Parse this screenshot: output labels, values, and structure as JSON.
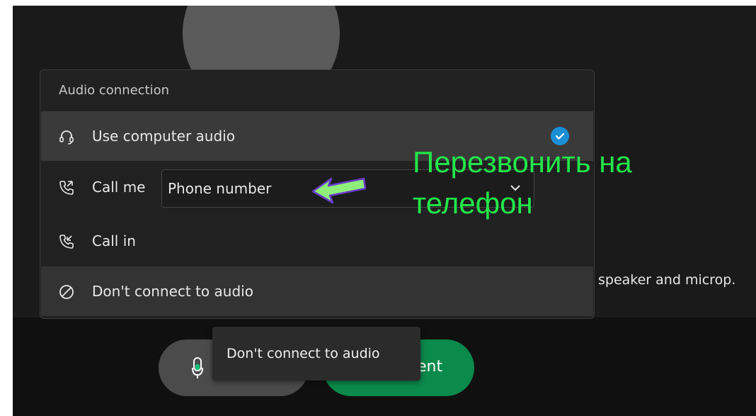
{
  "panel": {
    "title": "Audio connection",
    "options": [
      {
        "label": "Use computer audio",
        "icon": "headset-icon",
        "selected": true
      },
      {
        "label": "Call me",
        "icon": "phone-outgoing-icon"
      },
      {
        "label": "Call in",
        "icon": "phone-incoming-icon"
      },
      {
        "label": "Don't connect to audio",
        "icon": "block-icon"
      }
    ],
    "phone_placeholder": "Phone number"
  },
  "background": {
    "speaker_text": "speaker and microp."
  },
  "buttons": {
    "join_label_fragment": "ent"
  },
  "tooltip": {
    "text": "Don't connect to audio"
  },
  "annotation": {
    "line1": "Перезвонить на",
    "line2": "телефон"
  },
  "colors": {
    "accent_green": "#22e84a",
    "selected_check": "#1a8fd6",
    "join_button": "#0a8a4b"
  }
}
